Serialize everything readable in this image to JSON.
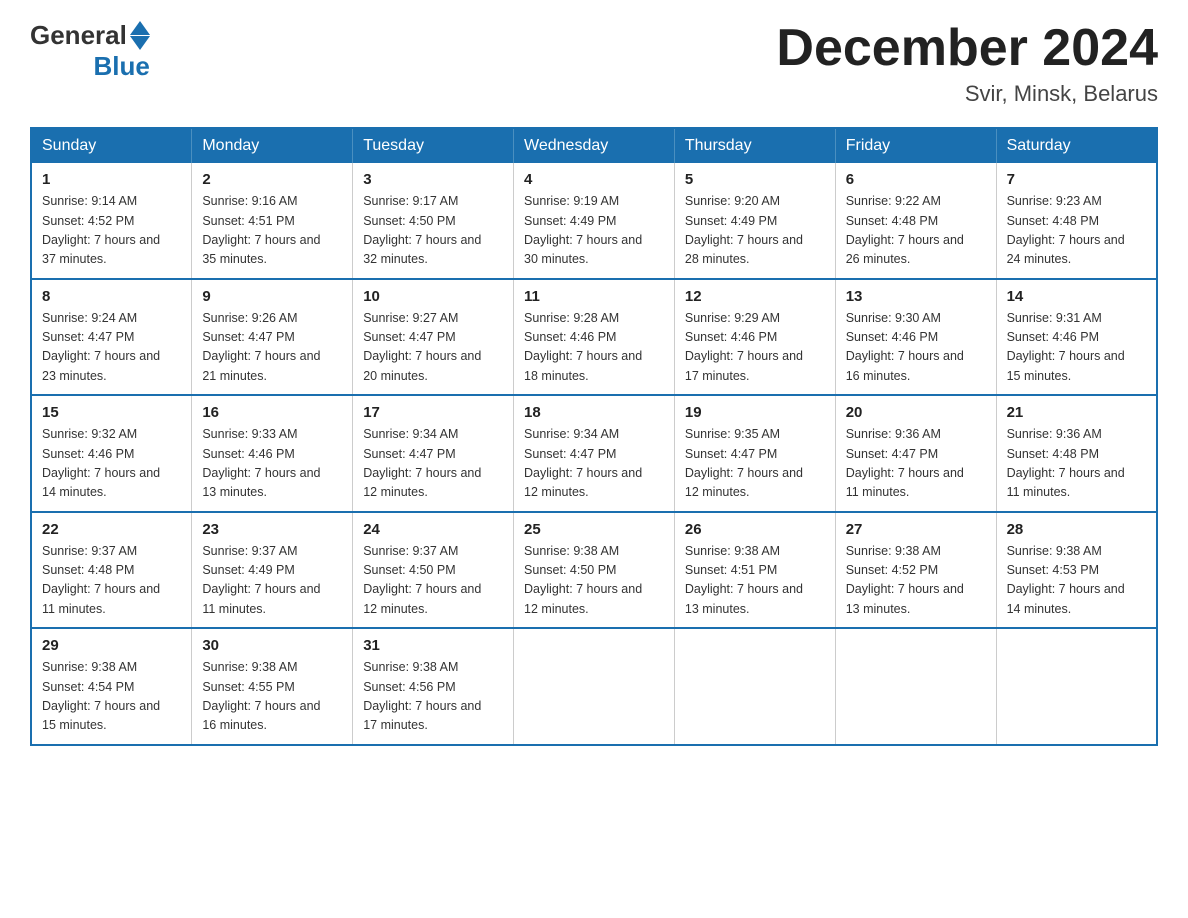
{
  "header": {
    "logo_general": "General",
    "logo_blue": "Blue",
    "month_title": "December 2024",
    "location": "Svir, Minsk, Belarus"
  },
  "calendar": {
    "weekdays": [
      "Sunday",
      "Monday",
      "Tuesday",
      "Wednesday",
      "Thursday",
      "Friday",
      "Saturday"
    ],
    "weeks": [
      [
        {
          "day": "1",
          "sunrise": "9:14 AM",
          "sunset": "4:52 PM",
          "daylight": "7 hours and 37 minutes."
        },
        {
          "day": "2",
          "sunrise": "9:16 AM",
          "sunset": "4:51 PM",
          "daylight": "7 hours and 35 minutes."
        },
        {
          "day": "3",
          "sunrise": "9:17 AM",
          "sunset": "4:50 PM",
          "daylight": "7 hours and 32 minutes."
        },
        {
          "day": "4",
          "sunrise": "9:19 AM",
          "sunset": "4:49 PM",
          "daylight": "7 hours and 30 minutes."
        },
        {
          "day": "5",
          "sunrise": "9:20 AM",
          "sunset": "4:49 PM",
          "daylight": "7 hours and 28 minutes."
        },
        {
          "day": "6",
          "sunrise": "9:22 AM",
          "sunset": "4:48 PM",
          "daylight": "7 hours and 26 minutes."
        },
        {
          "day": "7",
          "sunrise": "9:23 AM",
          "sunset": "4:48 PM",
          "daylight": "7 hours and 24 minutes."
        }
      ],
      [
        {
          "day": "8",
          "sunrise": "9:24 AM",
          "sunset": "4:47 PM",
          "daylight": "7 hours and 23 minutes."
        },
        {
          "day": "9",
          "sunrise": "9:26 AM",
          "sunset": "4:47 PM",
          "daylight": "7 hours and 21 minutes."
        },
        {
          "day": "10",
          "sunrise": "9:27 AM",
          "sunset": "4:47 PM",
          "daylight": "7 hours and 20 minutes."
        },
        {
          "day": "11",
          "sunrise": "9:28 AM",
          "sunset": "4:46 PM",
          "daylight": "7 hours and 18 minutes."
        },
        {
          "day": "12",
          "sunrise": "9:29 AM",
          "sunset": "4:46 PM",
          "daylight": "7 hours and 17 minutes."
        },
        {
          "day": "13",
          "sunrise": "9:30 AM",
          "sunset": "4:46 PM",
          "daylight": "7 hours and 16 minutes."
        },
        {
          "day": "14",
          "sunrise": "9:31 AM",
          "sunset": "4:46 PM",
          "daylight": "7 hours and 15 minutes."
        }
      ],
      [
        {
          "day": "15",
          "sunrise": "9:32 AM",
          "sunset": "4:46 PM",
          "daylight": "7 hours and 14 minutes."
        },
        {
          "day": "16",
          "sunrise": "9:33 AM",
          "sunset": "4:46 PM",
          "daylight": "7 hours and 13 minutes."
        },
        {
          "day": "17",
          "sunrise": "9:34 AM",
          "sunset": "4:47 PM",
          "daylight": "7 hours and 12 minutes."
        },
        {
          "day": "18",
          "sunrise": "9:34 AM",
          "sunset": "4:47 PM",
          "daylight": "7 hours and 12 minutes."
        },
        {
          "day": "19",
          "sunrise": "9:35 AM",
          "sunset": "4:47 PM",
          "daylight": "7 hours and 12 minutes."
        },
        {
          "day": "20",
          "sunrise": "9:36 AM",
          "sunset": "4:47 PM",
          "daylight": "7 hours and 11 minutes."
        },
        {
          "day": "21",
          "sunrise": "9:36 AM",
          "sunset": "4:48 PM",
          "daylight": "7 hours and 11 minutes."
        }
      ],
      [
        {
          "day": "22",
          "sunrise": "9:37 AM",
          "sunset": "4:48 PM",
          "daylight": "7 hours and 11 minutes."
        },
        {
          "day": "23",
          "sunrise": "9:37 AM",
          "sunset": "4:49 PM",
          "daylight": "7 hours and 11 minutes."
        },
        {
          "day": "24",
          "sunrise": "9:37 AM",
          "sunset": "4:50 PM",
          "daylight": "7 hours and 12 minutes."
        },
        {
          "day": "25",
          "sunrise": "9:38 AM",
          "sunset": "4:50 PM",
          "daylight": "7 hours and 12 minutes."
        },
        {
          "day": "26",
          "sunrise": "9:38 AM",
          "sunset": "4:51 PM",
          "daylight": "7 hours and 13 minutes."
        },
        {
          "day": "27",
          "sunrise": "9:38 AM",
          "sunset": "4:52 PM",
          "daylight": "7 hours and 13 minutes."
        },
        {
          "day": "28",
          "sunrise": "9:38 AM",
          "sunset": "4:53 PM",
          "daylight": "7 hours and 14 minutes."
        }
      ],
      [
        {
          "day": "29",
          "sunrise": "9:38 AM",
          "sunset": "4:54 PM",
          "daylight": "7 hours and 15 minutes."
        },
        {
          "day": "30",
          "sunrise": "9:38 AM",
          "sunset": "4:55 PM",
          "daylight": "7 hours and 16 minutes."
        },
        {
          "day": "31",
          "sunrise": "9:38 AM",
          "sunset": "4:56 PM",
          "daylight": "7 hours and 17 minutes."
        },
        null,
        null,
        null,
        null
      ]
    ]
  }
}
